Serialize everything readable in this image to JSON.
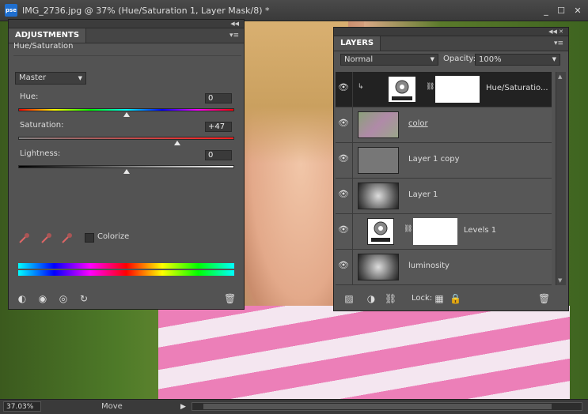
{
  "window": {
    "app_icon": "pse",
    "title": "IMG_2736.jpg @ 37% (Hue/Saturation 1, Layer Mask/8) *",
    "minimize": "_",
    "restore": "☐",
    "close": "✕"
  },
  "status": {
    "zoom": "37.03%",
    "tool": "Move",
    "arrow": "▶"
  },
  "adjustments": {
    "tab": "ADJUSTMENTS",
    "subtitle": "Hue/Saturation",
    "channel": "Master",
    "hue_label": "Hue:",
    "hue_value": "0",
    "sat_label": "Saturation:",
    "sat_value": "+47",
    "light_label": "Lightness:",
    "light_value": "0",
    "colorize_label": "Colorize",
    "levels": {
      "hue": 0.5,
      "saturation": 0.735,
      "lightness": 0.5
    }
  },
  "layers": {
    "tab": "LAYERS",
    "blend_mode": "Normal",
    "opacity_label": "Opacity:",
    "opacity_value": "100%",
    "lock_label": "Lock:",
    "items": [
      {
        "name": "Hue/Saturatio...",
        "selected": true
      },
      {
        "name": "color",
        "selected": false
      },
      {
        "name": "Layer 1 copy",
        "selected": false
      },
      {
        "name": "Layer 1",
        "selected": false
      },
      {
        "name": "Levels 1",
        "selected": false
      },
      {
        "name": "luminosity",
        "selected": false
      }
    ]
  },
  "colors": {
    "panel_bg": "#535353",
    "selected_row": "#222222",
    "accent": "#1f6fd0"
  }
}
